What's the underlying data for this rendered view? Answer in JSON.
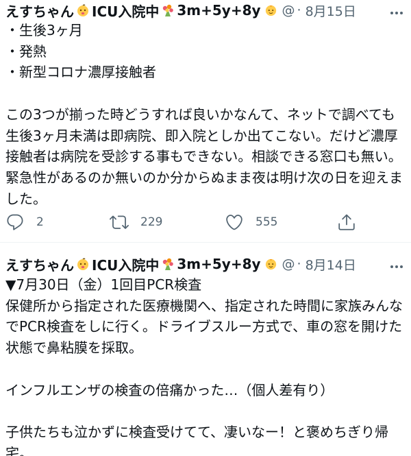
{
  "tweets": [
    {
      "display_name": "えすちゃん",
      "name_text": "ICU入院中",
      "name_suffix": "3m+5y+8y",
      "handle": "@",
      "separator": "·",
      "date": "8月15日",
      "body": "・生後3ヶ月\n・発熱\n・新型コロナ濃厚接触者\n\nこの3つが揃った時どうすれば良いかなんて、ネットで調べても生後3ヶ月未満は即病院、即入院としか出てこない。だけど濃厚接触者は病院を受診する事もできない。相談できる窓口も無い。緊急性があるのか無いのか分からぬまま夜は明け次の日を迎えました。",
      "actions": {
        "reply_count": "2",
        "retweet_count": "229",
        "like_count": "555"
      }
    },
    {
      "display_name": "えすちゃん",
      "name_text": "ICU入院中",
      "name_suffix": "3m+5y+8y",
      "handle": "@",
      "separator": "·",
      "date": "8月14日",
      "body": "▼7月30日（金）1回目PCR検査\n保健所から指定された医療機関へ、指定された時間に家族みんなでPCR検査をしに行く。ドライブスルー方式で、車の窓を開けた状態で鼻粘膜を採取。\n\nインフルエンザの検査の倍痛かった…（個人差有り）\n\n子供たちも泣かずに検査受けてて、凄いなー！と褒めちぎり帰宅。"
    }
  ],
  "icons": {
    "emoji_1": "baby-emoji-icon",
    "emoji_2": "bouquet-emoji-icon",
    "emoji_3": "baby-face-emoji-icon",
    "more": "more-dots-icon",
    "reply": "reply-icon",
    "retweet": "retweet-icon",
    "like": "heart-icon",
    "share": "share-icon"
  },
  "colors": {
    "text": "#0f1419",
    "secondary": "#536471",
    "divider": "#eff3f4"
  }
}
